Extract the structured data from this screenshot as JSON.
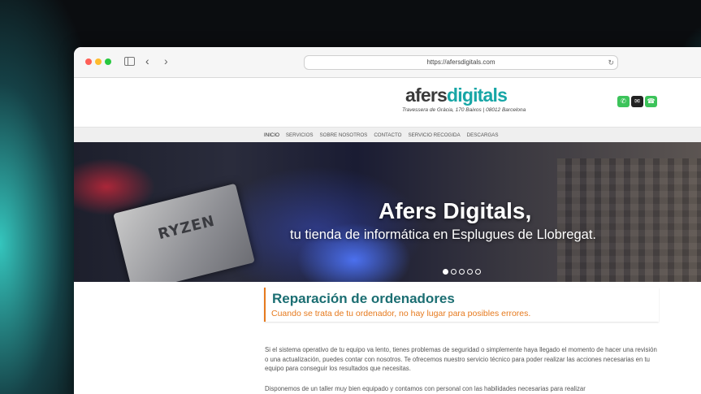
{
  "browser": {
    "url": "https://afersdigitals.com"
  },
  "site": {
    "logo_part1": "afers",
    "logo_part2": "digitals",
    "address": "Travessera de Gràcia, 170 Baixos | 08012 Barcelona",
    "menu": [
      "INICIO",
      "SERVICIOS",
      "SOBRE NOSOTROS",
      "CONTACTO",
      "SERVICIO RECOGIDA",
      "DESCARGAS"
    ]
  },
  "hero": {
    "title": "Afers Digitals,",
    "subtitle": "tu tienda de informática en Esplugues de Llobregat.",
    "cpu_text": "RYZEN",
    "slide_count": 5,
    "active_slide": 1
  },
  "section": {
    "title": "Reparación de ordenadores",
    "subtitle": "Cuando se trata de tu ordenador, no hay lugar para posibles errores.",
    "paragraph1": "Si el sistema operativo de tu equipo va lento, tienes problemas de seguridad o simplemente haya llegado el momento de hacer una revisión o una actualización, puedes contar con nosotros. Te ofrecemos nuestro servicio técnico para poder realizar las acciones necesarias en tu equipo para conseguir los resultados que necesitas.",
    "paragraph2": "Disponemos de un taller muy bien equipado y contamos con personal con las habilidades necesarias para realizar"
  },
  "colors": {
    "brand_teal": "#17a6a6",
    "accent_orange": "#e67a1e",
    "heading_teal": "#1b6e72"
  }
}
